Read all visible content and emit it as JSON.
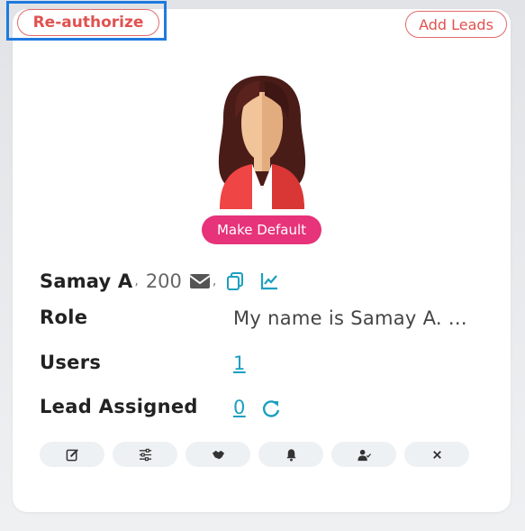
{
  "header": {
    "reauthorize_label": "Re-authorize",
    "add_leads_label": "Add Leads"
  },
  "profile": {
    "make_default_label": "Make Default",
    "name": "Samay A",
    "phone": "200"
  },
  "details": {
    "role_label": "Role",
    "role_value": "My name is Samay A. ...",
    "users_label": "Users",
    "users_value": "1",
    "lead_assigned_label": "Lead Assigned",
    "lead_assigned_value": "0"
  },
  "actions": [
    {
      "icon": "edit-icon"
    },
    {
      "icon": "sliders-icon"
    },
    {
      "icon": "handshake-icon"
    },
    {
      "icon": "bell-icon"
    },
    {
      "icon": "user-check-icon"
    },
    {
      "icon": "close-icon"
    }
  ],
  "colors": {
    "accent_red": "#e0524f",
    "make_default_bg": "#e6337a",
    "link": "#1a9fc0",
    "focus_outline": "#1f7ae0"
  }
}
